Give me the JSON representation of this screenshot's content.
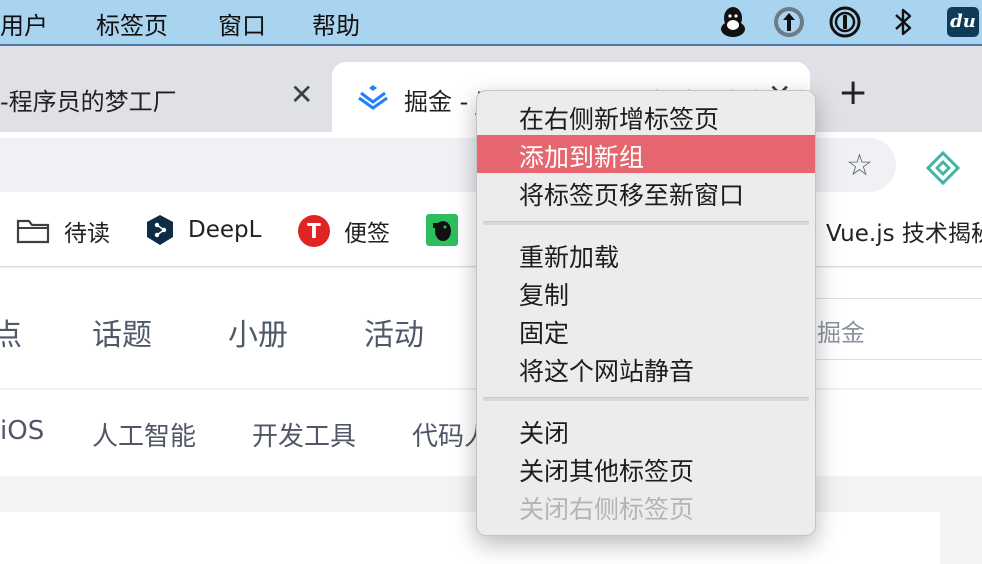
{
  "menubar": {
    "items": [
      "用户",
      "标签页",
      "窗口",
      "帮助"
    ],
    "tray_icons": [
      "qq-penguin-icon",
      "upload-arrow-icon",
      "onepassword-icon",
      "bluetooth-icon",
      "du-app-icon"
    ],
    "du_label": "du"
  },
  "tabs": [
    {
      "title": "-程序员的梦工厂",
      "close": "✕"
    },
    {
      "title": "掘金 - juejin.cn - 一个帮助开发者成长的社区",
      "close": "✕"
    }
  ],
  "new_tab": "+",
  "toolbar": {
    "star": "☆"
  },
  "bookmarks": [
    {
      "label": "待读",
      "icon": "folder-icon"
    },
    {
      "label": "DeepL",
      "icon": "deepl-icon"
    },
    {
      "label": "便签",
      "icon": "t-note-icon",
      "icon_text": "T"
    },
    {
      "label": "",
      "icon": "evernote-icon"
    },
    {
      "label": "Vue.js 技术揭秘",
      "icon": ""
    }
  ],
  "site_nav": {
    "items": [
      "点",
      "话题",
      "小册",
      "活动"
    ],
    "search_placeholder": "掘金"
  },
  "categories": [
    "iOS",
    "人工智能",
    "开发工具",
    "代码人生"
  ],
  "context_menu": {
    "groups": [
      [
        {
          "label": "在右侧新增标签页",
          "state": "normal"
        },
        {
          "label": "添加到新组",
          "state": "highlighted"
        },
        {
          "label": "将标签页移至新窗口",
          "state": "normal"
        }
      ],
      [
        {
          "label": "重新加载",
          "state": "normal"
        },
        {
          "label": "复制",
          "state": "normal"
        },
        {
          "label": "固定",
          "state": "normal"
        },
        {
          "label": "将这个网站静音",
          "state": "normal"
        }
      ],
      [
        {
          "label": "关闭",
          "state": "normal"
        },
        {
          "label": "关闭其他标签页",
          "state": "normal"
        },
        {
          "label": "关闭右侧标签页",
          "state": "disabled"
        }
      ]
    ]
  },
  "colors": {
    "menubar_bg": "#a9d4ef",
    "highlight": "#e5666e",
    "juejin_blue": "#1e80ff",
    "deepl_navy": "#0f2b46",
    "note_red": "#e02424",
    "evernote_green": "#2dbe60"
  }
}
